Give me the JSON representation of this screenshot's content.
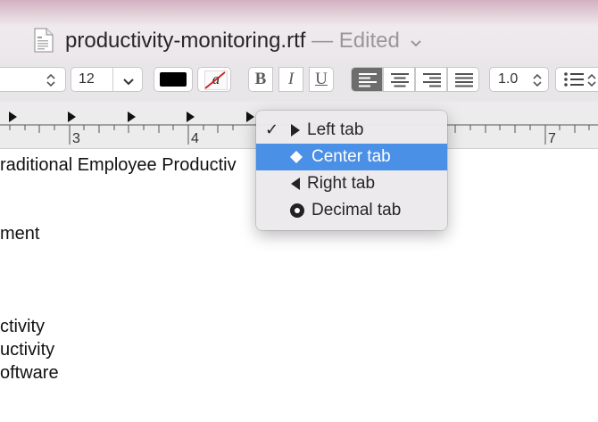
{
  "window": {
    "filename": "productivity-monitoring.rtf",
    "status": "— Edited"
  },
  "toolbar": {
    "font_size": "12",
    "text_color": "#000000",
    "highlight_glyph": "a",
    "bold_label": "B",
    "italic_label": "I",
    "underline_label": "U",
    "alignment_selected": "left",
    "line_spacing": "1.0"
  },
  "ruler": {
    "labels": [
      "3",
      "4",
      "7"
    ]
  },
  "document": {
    "lines": [
      "raditional Employee Productiv",
      "ment",
      "ctivity",
      "uctivity",
      "oftware"
    ]
  },
  "tab_menu": {
    "items": [
      {
        "label": "Left tab",
        "icon": "left-tab-triangle-icon",
        "checked": true
      },
      {
        "label": "Center tab",
        "icon": "center-tab-diamond-icon",
        "highlighted": true
      },
      {
        "label": "Right tab",
        "icon": "right-tab-triangle-icon"
      },
      {
        "label": "Decimal tab",
        "icon": "decimal-tab-circle-icon"
      }
    ]
  },
  "colors": {
    "menu_highlight": "#4a90e6",
    "active_align": "#6e6d6e"
  }
}
